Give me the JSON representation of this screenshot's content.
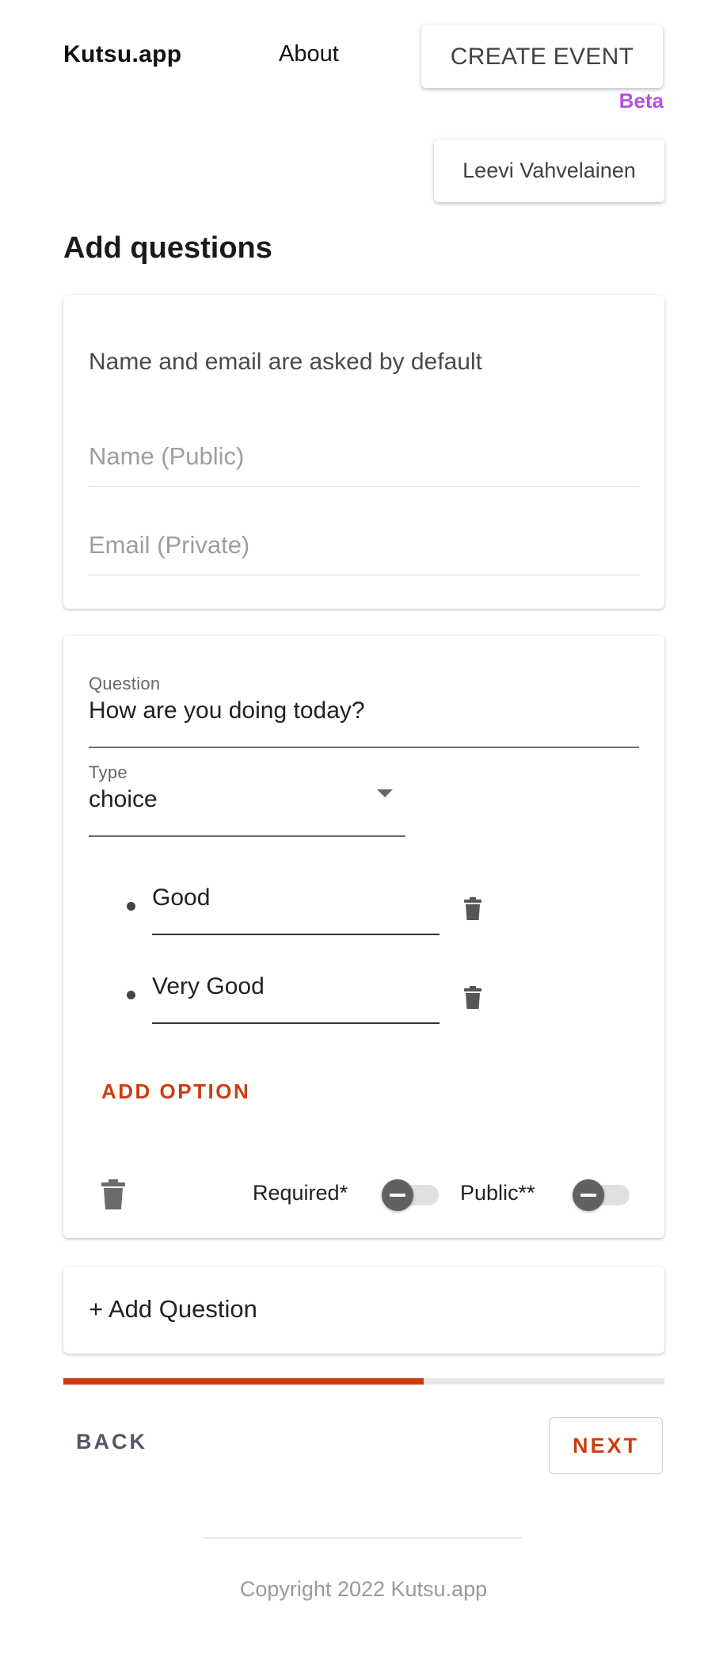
{
  "header": {
    "logo": "Kutsu.app",
    "about": "About",
    "create_event": "CREATE EVENT",
    "beta": "Beta",
    "user": "Leevi Vahvelainen"
  },
  "page": {
    "title": "Add questions"
  },
  "defaults_card": {
    "note": "Name and email are asked by default",
    "name_placeholder": "Name (Public)",
    "email_placeholder": "Email (Private)"
  },
  "question_card": {
    "question_label": "Question",
    "question_value": "How are you doing today?",
    "type_label": "Type",
    "type_value": "choice",
    "options": [
      "Good",
      "Very Good"
    ],
    "add_option": "ADD OPTION",
    "required_label": "Required*",
    "public_label": "Public**",
    "required_on": false,
    "public_on": false
  },
  "add_question": "+ Add Question",
  "progress": {
    "fraction": 0.6
  },
  "nav": {
    "back": "BACK",
    "next": "NEXT"
  },
  "footer": {
    "copyright": "Copyright 2022 Kutsu.app"
  },
  "colors": {
    "accent": "#cc3d12",
    "beta": "#b84ee6"
  },
  "icons": {
    "delete": "trash-icon",
    "dropdown": "chevron-down-icon"
  }
}
